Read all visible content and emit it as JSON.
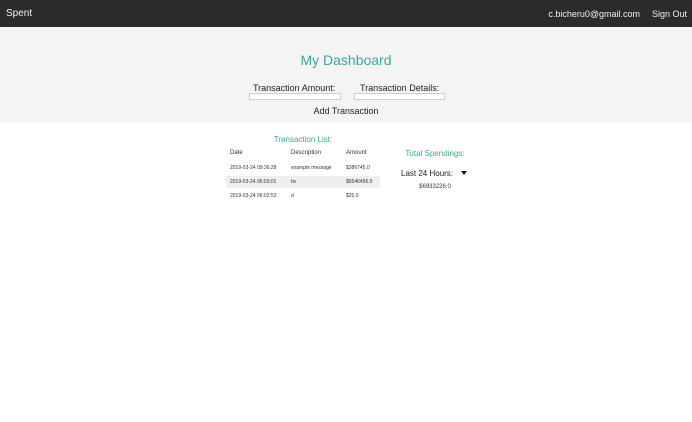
{
  "nav": {
    "brand": "Spent",
    "user_email": "c.bicheru0@gmail.com",
    "signout_label": "Sign Out"
  },
  "dashboard": {
    "title": "My Dashboard",
    "amount_label": "Transaction Amount:",
    "amount_value": "",
    "details_label": "Transaction Details:",
    "details_value": "",
    "add_label": "Add Transaction"
  },
  "transactions": {
    "title": "Transaction List:",
    "headers": [
      "Date",
      "Description",
      "Amount"
    ],
    "rows": [
      [
        "2019-03-24 09:36:28",
        "example message",
        "$386745.0"
      ],
      [
        "2019-03-24 06:03:01",
        "bv",
        "$6546456.0"
      ],
      [
        "2019-03-24 06:02:53",
        "d",
        "$25.0"
      ]
    ]
  },
  "spendings": {
    "title": "Total Spendings:",
    "period": "Last 24 Hours:",
    "total": "$6933226.0"
  },
  "colors": {
    "nav_bg": "#2b2b2b",
    "accent": "#3aa89a",
    "hero_bg": "#f4f4f4"
  }
}
